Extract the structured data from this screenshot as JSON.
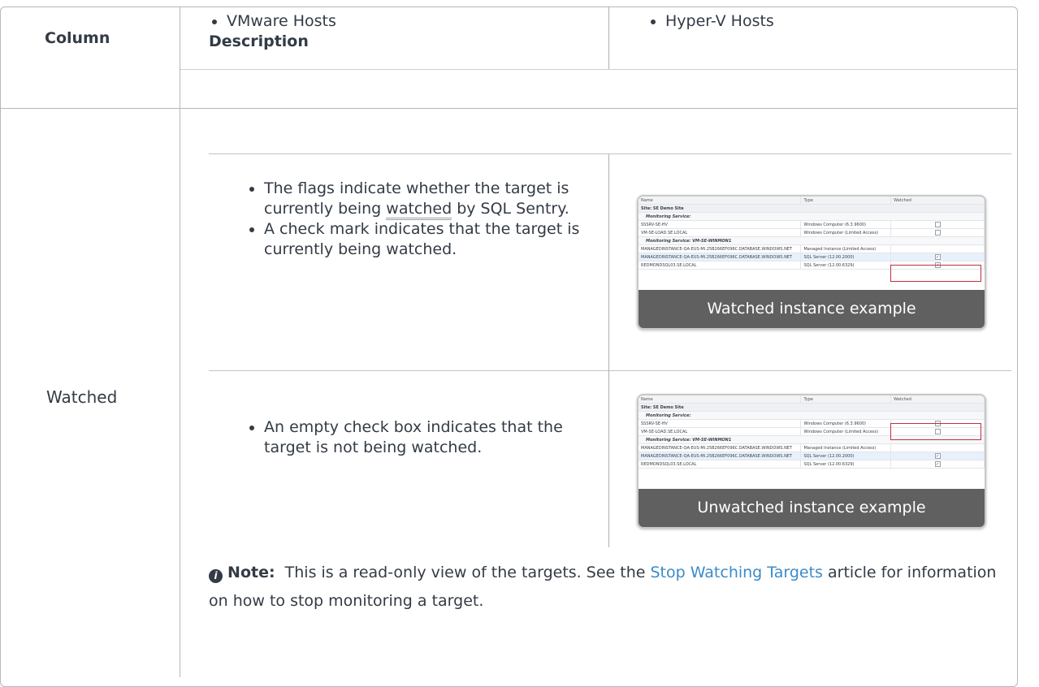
{
  "header": {
    "column_label": "Column",
    "description_label": "Description",
    "top_bullets": [
      "VMware Hosts",
      "Hyper-V Hosts"
    ]
  },
  "row": {
    "column_name": "Watched",
    "watched": {
      "bullet1_pre": "The flags indicate whether the target is currently being ",
      "bullet1_link": "watched",
      "bullet1_post": " by SQL Sentry.",
      "bullet2": "A check mark indicates that the target is currently being watched.",
      "caption": "Watched instance example"
    },
    "unwatched": {
      "bullet1": "An empty check box indicates that the target is not being watched.",
      "caption": "Unwatched instance example"
    }
  },
  "screenshot_grid": {
    "col_name": "Name",
    "col_type": "Type",
    "col_watched": "Watched",
    "site": "Site: SE Demo Site",
    "svc1": "Monitoring Service:",
    "svc2": "Monitoring Service: VM-SE-WINMON1",
    "rows": [
      {
        "name": "SSSRV-SE-HV",
        "type": "Windows Computer (6.3.9600)"
      },
      {
        "name": "VM-SE-LOAD.SE.LOCAL",
        "type": "Windows Computer (Limited Access)"
      },
      {
        "name": "MANAGEDINSTANCE-QA-EUS-MI.25B266EF096C.DATABASE.WINDOWS.NET",
        "type": "Managed Instance (Limited Access)"
      },
      {
        "name": "MANAGEDINSTANCE-QA-EUS-MI.25B266EF096C.DATABASE.WINDOWS.NET",
        "type": "SQL Server (12.00.2000)"
      },
      {
        "name": "REDMONDSQL03.SE.LOCAL",
        "type": "SQL Server (12.00.6329)"
      }
    ]
  },
  "note": {
    "icon": "info-circle-icon",
    "label": "Note:",
    "text_before": "  This is a read-only view of the targets. See the ",
    "link": "Stop Watching Targets",
    "text_after": " article for information on how to stop monitoring a target."
  },
  "colors": {
    "border": "#b7b7b7",
    "caption_bg": "#606060",
    "link": "#3b8bc9",
    "highlight": "#c03040"
  }
}
